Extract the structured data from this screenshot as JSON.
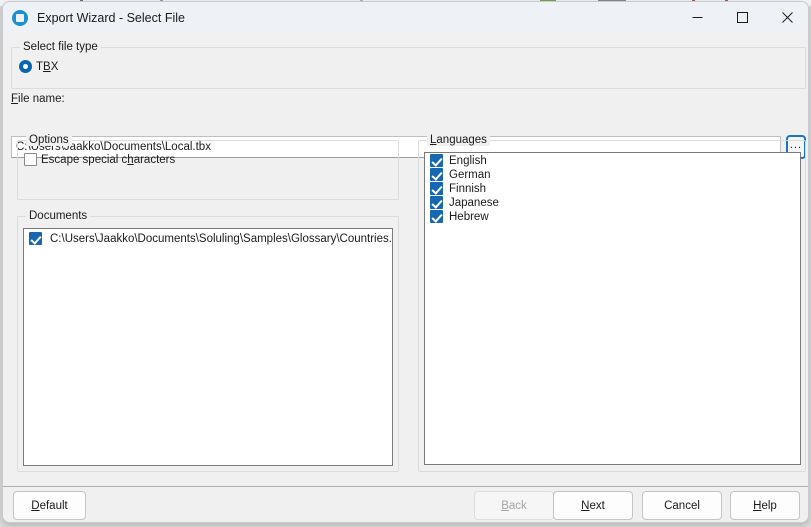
{
  "window": {
    "title": "Export Wizard - Select File",
    "icon": "circle-minus-icon",
    "controls": {
      "minimize": "minimize-icon",
      "maximize": "maximize-icon",
      "close": "close-icon"
    }
  },
  "accent": "#0a64b4",
  "checkbox_color": "#1767b3",
  "focus_color": "#1a73c8",
  "file_type_group": {
    "title_pre": "Select file t",
    "title_acc": "",
    "title": "Select file type",
    "options": [
      {
        "label_pre": "T",
        "label_acc": "B",
        "label_post": "X",
        "checked": true
      }
    ]
  },
  "file_name": {
    "label_acc": "F",
    "label_post": "ile name:",
    "value": "C:\\Users\\Jaakko\\Documents\\Local.tbx",
    "placeholder": "",
    "browse_label": "..."
  },
  "options_group": {
    "title": "Options",
    "items": [
      {
        "label_pre": "Escape special c",
        "label_acc": "h",
        "label_post": "aracters",
        "checked": false
      }
    ]
  },
  "languages_group": {
    "title_acc": "L",
    "title_post": "anguages",
    "items": [
      {
        "label": "English",
        "checked": true
      },
      {
        "label": "German",
        "checked": true
      },
      {
        "label": "Finnish",
        "checked": true
      },
      {
        "label": "Japanese",
        "checked": true
      },
      {
        "label": "Hebrew",
        "checked": true
      }
    ]
  },
  "documents_group": {
    "title": "Documents",
    "items": [
      {
        "label": "C:\\Users\\Jaakko\\Documents\\Soluling\\Samples\\Glossary\\Countries.tbx",
        "checked": true
      }
    ]
  },
  "buttons": {
    "default": {
      "pre": "",
      "acc": "D",
      "post": "efault",
      "disabled": false
    },
    "back": {
      "pre": "",
      "acc": "B",
      "post": "ack",
      "disabled": true
    },
    "next": {
      "pre": "",
      "acc": "N",
      "post": "ext",
      "disabled": false
    },
    "cancel": {
      "pre": "Cancel",
      "acc": "",
      "post": "",
      "disabled": false
    },
    "help": {
      "pre": "",
      "acc": "H",
      "post": "elp",
      "disabled": false
    }
  }
}
